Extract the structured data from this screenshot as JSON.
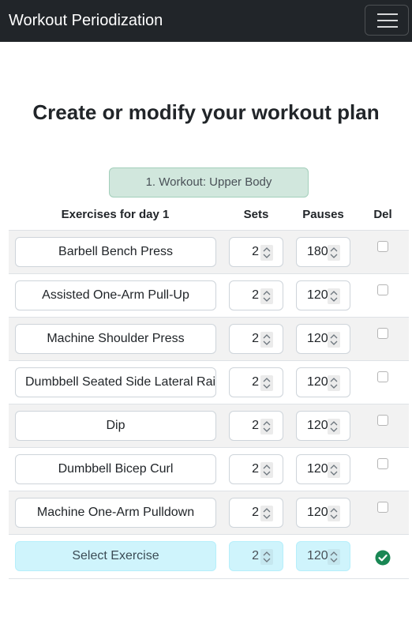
{
  "navbar": {
    "brand": "Workout Periodization",
    "toggler_icon": "hamburger-menu-icon"
  },
  "page": {
    "heading": "Create or modify your workout plan",
    "workout_label": "1. Workout: Upper Body"
  },
  "table": {
    "headers": {
      "exercise": "Exercises for day 1",
      "sets": "Sets",
      "pauses": "Pauses",
      "del": "Del"
    },
    "rows": [
      {
        "exercise": "Barbell Bench Press",
        "sets": "2",
        "pause": "180",
        "delete_checked": false
      },
      {
        "exercise": "Assisted One-Arm Pull-Up",
        "sets": "2",
        "pause": "120",
        "delete_checked": false
      },
      {
        "exercise": "Machine Shoulder Press",
        "sets": "2",
        "pause": "120",
        "delete_checked": false
      },
      {
        "exercise": "Dumbbell Seated Side Lateral Raise",
        "sets": "2",
        "pause": "120",
        "delete_checked": false
      },
      {
        "exercise": "Dip",
        "sets": "2",
        "pause": "120",
        "delete_checked": false
      },
      {
        "exercise": "Dumbbell Bicep Curl",
        "sets": "2",
        "pause": "120",
        "delete_checked": false
      },
      {
        "exercise": "Machine One-Arm Pulldown",
        "sets": "2",
        "pause": "120",
        "delete_checked": false
      }
    ],
    "new_row": {
      "exercise_placeholder": "Select Exercise",
      "sets": "2",
      "pause": "120",
      "confirm_icon": "checkmark-circle-icon"
    }
  },
  "colors": {
    "navbar_bg": "#212529",
    "workout_pill_bg": "#d1e7dd",
    "new_row_bg": "#cff4fc",
    "confirm_green": "#198754",
    "stripe_bg": "#f2f2f2"
  }
}
